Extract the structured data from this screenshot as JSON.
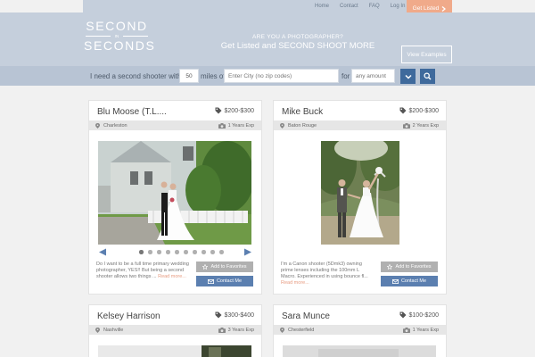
{
  "nav": {
    "links": [
      "Home",
      "Contact",
      "FAQ",
      "Log In"
    ],
    "get_listed": "Get Listed"
  },
  "logo": {
    "line1": "SECOND",
    "line2": "IN",
    "line3": "SECONDS"
  },
  "promo": {
    "line1": "ARE YOU A PHOTOGRAPHER?",
    "line2": "Get Listed and SECOND SHOOT MORE",
    "button": "View Examples"
  },
  "search": {
    "prefix": "I need a second shooter within",
    "miles_value": "50",
    "miles_label": "miles of",
    "city_placeholder": "Enter City (no zip codes)",
    "for_label": "for",
    "amount_placeholder": "any amount"
  },
  "colors": {
    "accent": "#3f6a9c",
    "cta": "#f0aa8a",
    "header_bg": "#c5cfdc"
  },
  "cards": [
    {
      "name": "Blu Moose (T.L....",
      "price": "$200-$300",
      "location": "Charleston",
      "experience": "1 Years Exp",
      "description": "Do I want to be a full time primary wedding photographer, YES!! But being a second shooter allows two things ... ",
      "read_more": "Read more...",
      "favorite": "Add to Favorites",
      "contact": "Contact Me"
    },
    {
      "name": "Mike Buck",
      "price": "$200-$300",
      "location": "Baton Rouge",
      "experience": "2 Years Exp",
      "description": "I'm a Canon shooter (5Dmk3) owning prime lenses including the 100mm L Macro. Experienced in using bounce fl... ",
      "read_more": "Read more...",
      "favorite": "Add to Favorites",
      "contact": "Contact Me"
    },
    {
      "name": "Kelsey Harrison",
      "price": "$300-$400",
      "location": "Nashville",
      "experience": "3 Years Exp"
    },
    {
      "name": "Sara Munce",
      "price": "$100-$200",
      "location": "Chesterfield",
      "experience": "1 Years Exp"
    }
  ],
  "carousel": {
    "dot_count": 10,
    "active_index": 0
  }
}
